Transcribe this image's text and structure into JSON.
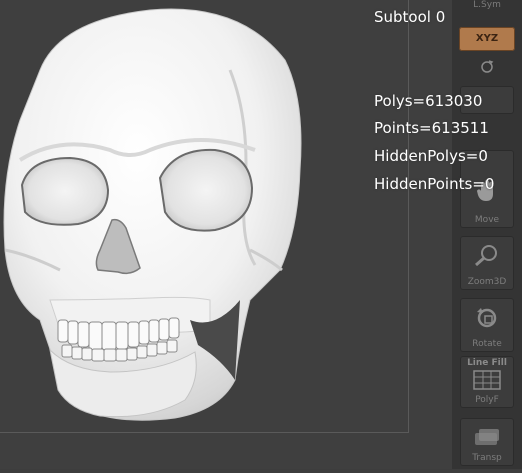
{
  "stats": {
    "subtool": "Subtool 0",
    "polys": "Polys=613030",
    "points": "Points=613511",
    "hidden_polys": "HiddenPolys=0",
    "hidden_points": "HiddenPoints=0"
  },
  "shelf": {
    "lsym_label": "L.Sym",
    "xyz_label": "XYZ",
    "move_label": "Move",
    "zoom_label": "Zoom3D",
    "rotate_label": "Rotate",
    "linefill_label": "Line Fill",
    "polyf_label": "PolyF",
    "transp_label": "Transp"
  },
  "colors": {
    "canvas_bg": "#3f3f3f",
    "active_accent": "#b07a4c",
    "model_material": "#eeeeee"
  }
}
